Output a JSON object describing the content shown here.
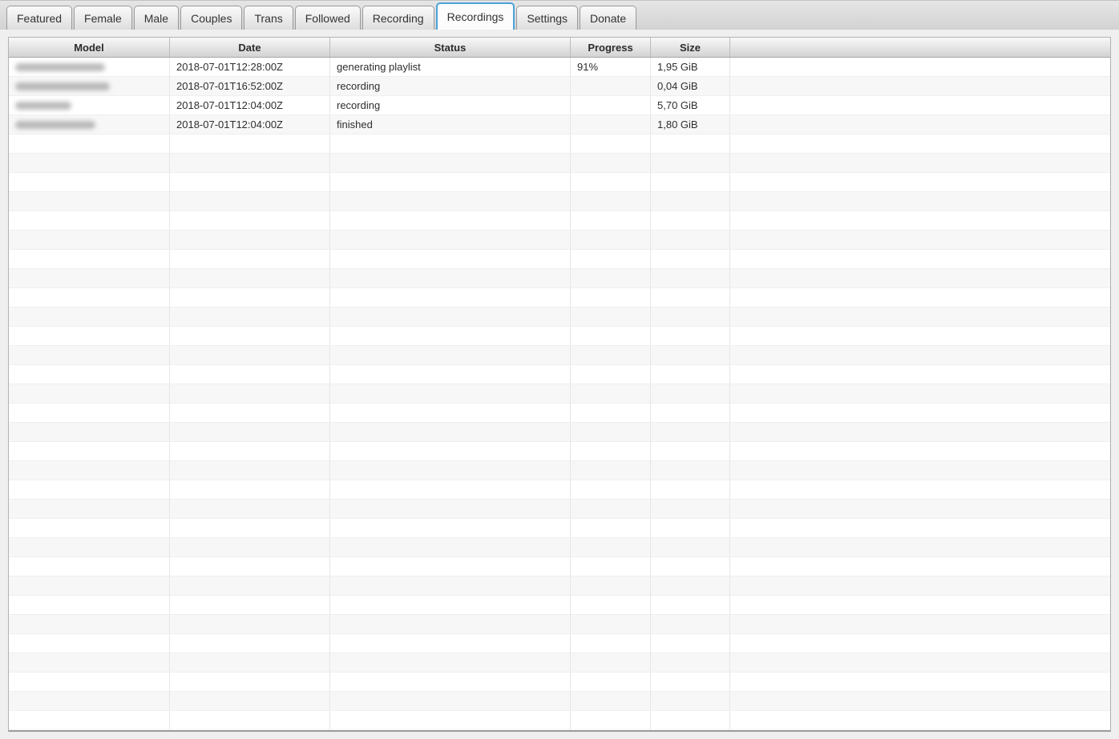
{
  "tabs": [
    {
      "label": "Featured",
      "selected": false
    },
    {
      "label": "Female",
      "selected": false
    },
    {
      "label": "Male",
      "selected": false
    },
    {
      "label": "Couples",
      "selected": false
    },
    {
      "label": "Trans",
      "selected": false
    },
    {
      "label": "Followed",
      "selected": false
    },
    {
      "label": "Recording",
      "selected": false
    },
    {
      "label": "Recordings",
      "selected": true
    },
    {
      "label": "Settings",
      "selected": false
    },
    {
      "label": "Donate",
      "selected": false
    }
  ],
  "table": {
    "columns": [
      "Model",
      "Date",
      "Status",
      "Progress",
      "Size",
      ""
    ],
    "rows": [
      {
        "model_redacted": true,
        "model_blur_width": 112,
        "date": "2018-07-01T12:28:00Z",
        "status": "generating playlist",
        "progress": "91%",
        "size": "1,95 GiB"
      },
      {
        "model_redacted": true,
        "model_blur_width": 118,
        "date": "2018-07-01T16:52:00Z",
        "status": "recording",
        "progress": "",
        "size": "0,04 GiB"
      },
      {
        "model_redacted": true,
        "model_blur_width": 70,
        "date": "2018-07-01T12:04:00Z",
        "status": "recording",
        "progress": "",
        "size": "5,70 GiB"
      },
      {
        "model_redacted": true,
        "model_blur_width": 100,
        "date": "2018-07-01T12:04:00Z",
        "status": "finished",
        "progress": "",
        "size": "1,80 GiB"
      }
    ],
    "empty_row_count": 31
  },
  "colors": {
    "selected_tab_border": "#4aa2d9",
    "row_stripe": "#f7f7f7",
    "header_gradient_top": "#f8f8f8",
    "header_gradient_bottom": "#d3d3d3"
  }
}
